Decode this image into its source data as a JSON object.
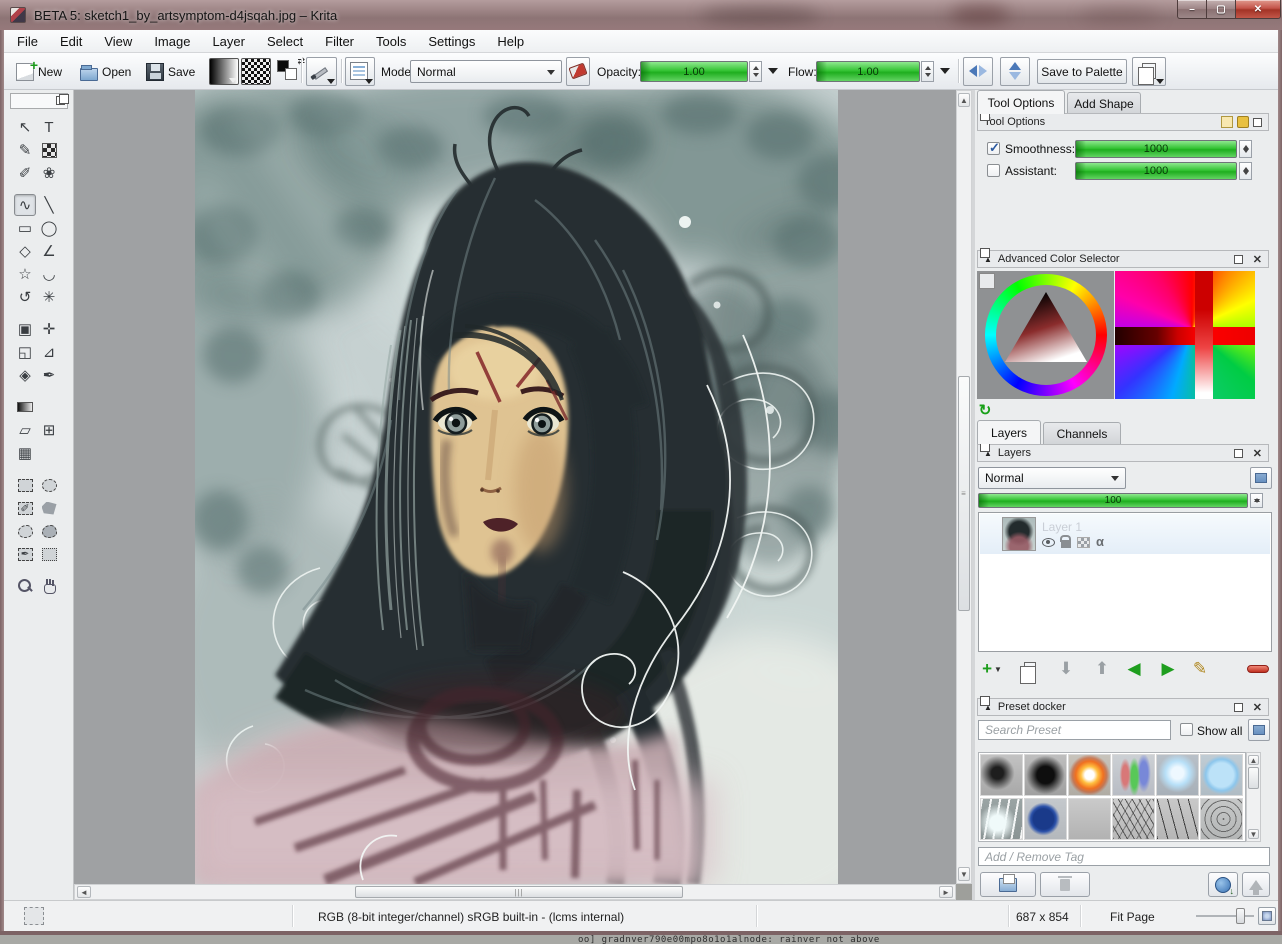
{
  "window": {
    "title": "BETA 5: sketch1_by_artsymptom-d4jsqah.jpg – Krita"
  },
  "menu": {
    "items": [
      "File",
      "Edit",
      "View",
      "Image",
      "Layer",
      "Select",
      "Filter",
      "Tools",
      "Settings",
      "Help"
    ]
  },
  "toolbar": {
    "new_label": "New",
    "open_label": "Open",
    "save_label": "Save",
    "mode_label": "Mode:",
    "mode_value": "Normal",
    "opacity_label": "Opacity:",
    "opacity_value": "1.00",
    "flow_label": "Flow:",
    "flow_value": "1.00",
    "save_to_palette_label": "Save to Palette"
  },
  "toolbox": {
    "rows": [
      {
        "gap": false,
        "cells": [
          {
            "name": "select-shapes-tool",
            "kind": "glyph",
            "glyph": "↖"
          },
          {
            "name": "text-tool",
            "kind": "glyph",
            "glyph": "T"
          }
        ]
      },
      {
        "gap": false,
        "cells": [
          {
            "name": "edit-shapes-tool",
            "kind": "glyph",
            "glyph": "✎"
          },
          {
            "name": "pattern-edit-tool",
            "kind": "checker",
            "glyph": ""
          }
        ]
      },
      {
        "gap": false,
        "cells": [
          {
            "name": "calligraphy-tool",
            "kind": "glyph",
            "glyph": "✐"
          },
          {
            "name": "artistic-color-tool",
            "kind": "glyph",
            "glyph": "❀"
          }
        ]
      },
      {
        "gap": true,
        "cells": [
          {
            "name": "freehand-brush-tool",
            "kind": "glyph",
            "glyph": "∿",
            "selected": true
          },
          {
            "name": "line-tool",
            "kind": "glyph",
            "glyph": "╲"
          }
        ]
      },
      {
        "gap": false,
        "cells": [
          {
            "name": "rectangle-tool",
            "kind": "glyph",
            "glyph": "▭"
          },
          {
            "name": "ellipse-tool",
            "kind": "glyph",
            "glyph": "◯"
          }
        ]
      },
      {
        "gap": false,
        "cells": [
          {
            "name": "polygon-tool",
            "kind": "glyph",
            "glyph": "◇"
          },
          {
            "name": "polyline-tool",
            "kind": "glyph",
            "glyph": "∠"
          }
        ]
      },
      {
        "gap": false,
        "cells": [
          {
            "name": "star-tool",
            "kind": "glyph",
            "glyph": "☆"
          },
          {
            "name": "curve-tool",
            "kind": "glyph",
            "glyph": "◡"
          }
        ]
      },
      {
        "gap": false,
        "cells": [
          {
            "name": "spiral-tool",
            "kind": "glyph",
            "glyph": "↺"
          },
          {
            "name": "multibrush-tool",
            "kind": "glyph",
            "glyph": "✳"
          }
        ]
      },
      {
        "gap": true,
        "cells": [
          {
            "name": "crop-tool",
            "kind": "glyph",
            "glyph": "▣"
          },
          {
            "name": "move-tool",
            "kind": "glyph",
            "glyph": "✛"
          }
        ]
      },
      {
        "gap": false,
        "cells": [
          {
            "name": "transform-tool",
            "kind": "glyph",
            "glyph": "◱"
          },
          {
            "name": "measure-tool",
            "kind": "glyph",
            "glyph": "⊿"
          }
        ]
      },
      {
        "gap": false,
        "cells": [
          {
            "name": "fill-tool",
            "kind": "glyph",
            "glyph": "◈"
          },
          {
            "name": "color-picker-tool",
            "kind": "glyph",
            "glyph": "✒"
          }
        ]
      },
      {
        "gap": true,
        "cells": [
          {
            "name": "gradient-tool",
            "kind": "gradient",
            "glyph": ""
          },
          null
        ]
      },
      {
        "gap": false,
        "cells": [
          {
            "name": "ruler-tool",
            "kind": "glyph",
            "glyph": "▱"
          },
          {
            "name": "perspective-grid-tool",
            "kind": "glyph",
            "glyph": "⊞"
          }
        ]
      },
      {
        "gap": false,
        "cells": [
          {
            "name": "grid-tool",
            "kind": "glyph",
            "glyph": "▦"
          },
          null
        ]
      },
      {
        "gap": true,
        "cells": [
          {
            "name": "rectangular-select-tool",
            "kind": "selrect",
            "glyph": ""
          },
          {
            "name": "elliptical-select-tool",
            "kind": "selellipse",
            "glyph": ""
          }
        ]
      },
      {
        "gap": false,
        "cells": [
          {
            "name": "paint-select-tool",
            "kind": "selpaint",
            "glyph": ""
          },
          {
            "name": "polygonal-select-tool",
            "kind": "selpoly",
            "glyph": ""
          }
        ]
      },
      {
        "gap": false,
        "cells": [
          {
            "name": "freehand-select-tool",
            "kind": "selblob",
            "glyph": ""
          },
          {
            "name": "similar-select-tool",
            "kind": "selsim",
            "glyph": ""
          }
        ]
      },
      {
        "gap": false,
        "cells": [
          {
            "name": "color-select-tool",
            "kind": "selpick",
            "glyph": ""
          },
          {
            "name": "warp-select-tool",
            "kind": "selwarp",
            "glyph": ""
          }
        ]
      },
      {
        "gap": true,
        "cells": [
          {
            "name": "zoom-tool",
            "kind": "zoomicon",
            "glyph": ""
          },
          {
            "name": "pan-tool",
            "kind": "handicon",
            "glyph": ""
          }
        ]
      }
    ]
  },
  "tool_options": {
    "tab_active": "Tool Options",
    "tab_inactive": "Add Shape",
    "header": "Tool Options",
    "rows": [
      {
        "label": "Smoothness:",
        "value": "1000",
        "checked": true
      },
      {
        "label": "Assistant:",
        "value": "1000",
        "checked": false
      }
    ]
  },
  "color_selector": {
    "header": "Advanced Color Selector"
  },
  "layers_docker": {
    "tab_active": "Layers",
    "tab_inactive": "Channels",
    "header": "Layers",
    "blend_mode": "Normal",
    "opacity_value": "100",
    "layer_name": "Layer 1"
  },
  "preset_docker": {
    "header": "Preset docker",
    "search_placeholder": "Search Preset",
    "show_all_label": "Show all",
    "tag_placeholder": "Add / Remove Tag",
    "presets": [
      {
        "name": "soft-dot-small",
        "style": "radial-gradient(circle at 40% 45%, #1e1e1e 0 18%, rgba(30,30,30,0) 52%), linear-gradient(#c2c2c2,#a8a8a8)"
      },
      {
        "name": "soft-dot-large",
        "style": "radial-gradient(circle at 50% 50%, #0e0e0e 0 30%, rgba(14,14,14,0) 68%), linear-gradient(#bebebe,#a0a0a0)"
      },
      {
        "name": "fire-burst",
        "style": "radial-gradient(circle at 50% 50%, #ffffff 0 16%, #ffc040 30%, #f07020 48%, rgba(200,80,30,.6) 60%, rgba(190,180,170,0) 72%), linear-gradient(#c8c4bc,#b0aca4)"
      },
      {
        "name": "color-streaks",
        "style": "radial-gradient(ellipse 20% 60% at 30% 50%, #d87878 0 40%, rgba(216,120,120,0) 70%), radial-gradient(ellipse 20% 70% at 52% 55%, #58c858 0 40%, rgba(88,200,88,0) 70%), radial-gradient(ellipse 25% 70% at 75% 45%, #7888d8 0 40%, rgba(120,136,216,0) 70%), linear-gradient(#ccd0d4,#b8bcc4)"
      },
      {
        "name": "soft-blue",
        "style": "radial-gradient(circle at 50% 45%, #eef8ff 0 20%, #b8e0f8 40%, rgba(184,224,248,0) 65%), linear-gradient(#b8c0c8,#a8b0b8)"
      },
      {
        "name": "blue-round",
        "style": "radial-gradient(circle at 50% 50%, #bce2f8 0 42%, #8cc6ec 55%, rgba(140,198,236,0) 68%), linear-gradient(#c0ccd4,#b0bcc4)"
      },
      {
        "name": "glow-squiggle",
        "style": "radial-gradient(circle at 40% 60%, #f0fafa 0 22%, rgba(240,250,250,0) 55%), repeating-linear-gradient(100deg, rgba(255,255,255,.9) 0 2px, rgba(255,255,255,0) 2px 9px), linear-gradient(#9aa4a4,#8a9494)"
      },
      {
        "name": "ink-blob",
        "style": "radial-gradient(circle at 45% 50%, #1a3a8a 0 34%, #2c52aa 42%, rgba(26,58,138,0) 55%), linear-gradient(#c4c8cc,#b4b8bc)"
      },
      {
        "name": "plain-gray",
        "style": "linear-gradient(#cacaca,#b2b2b2)"
      },
      {
        "name": "pencil-scribble",
        "style": "repeating-linear-gradient(60deg, rgba(60,60,60,.8) 0 1px, rgba(60,60,60,0) 1px 6px), repeating-linear-gradient(120deg, rgba(80,80,80,.6) 0 1px, rgba(80,80,80,0) 1px 8px), linear-gradient(#cccccc,#b8b8b8)"
      },
      {
        "name": "sketch-lines",
        "style": "repeating-linear-gradient(75deg, rgba(40,40,40,.85) 0 1px, rgba(40,40,40,0) 1px 10px), linear-gradient(#c8c8c8,#b6b6b6)"
      },
      {
        "name": "swirl-lines",
        "style": "repeating-radial-gradient(circle at 55% 50%, rgba(70,70,70,.7) 0 1px, rgba(70,70,70,0) 1px 6px), linear-gradient(#c6c8c8,#b4b6b6)"
      }
    ]
  },
  "status_bar": {
    "color_profile": "RGB (8-bit integer/channel)  sRGB built-in - (lcms internal)",
    "dimensions": "687 x 854",
    "zoom_mode": "Fit Page"
  },
  "desktop": {
    "console_text": "oo] gradnver790e00mpo8o1o1alnode: rainver not above"
  }
}
